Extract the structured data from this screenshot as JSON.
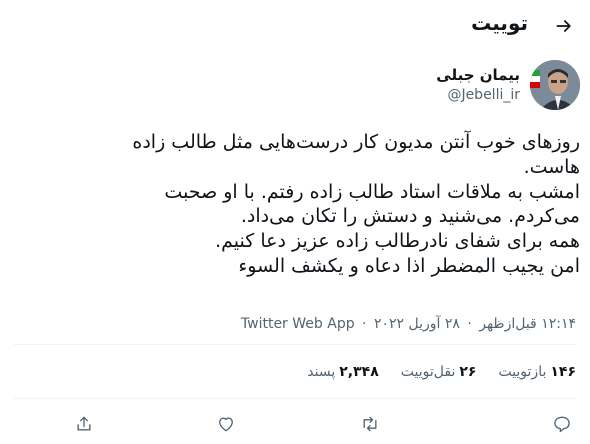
{
  "header": {
    "title": "توییت",
    "back_icon": "arrow-right-icon"
  },
  "author": {
    "name": "بیمان جبلی",
    "handle": "@Jebelli_ir"
  },
  "tweet": {
    "lines": [
      "روزهای خوب آنتن مدیون کار درست‌هایی مثل طالب زاده",
      "هاست.",
      "امشب به ملاقات استاد طالب زاده رفتم. با او صحبت",
      "می‌کردم. می‌شنید و دستش را تکان می‌داد.",
      "همه برای شفای نادرطالب زاده عزیز دعا کنیم.",
      "امن یجیب المضطر اذا دعاه و یکشف السوء"
    ]
  },
  "meta": {
    "time": "۱۲:۱۴ قبل‌ازظهر",
    "date": "۲۸ آوریل ۲۰۲۲",
    "source": "Twitter Web App",
    "separator": "·"
  },
  "stats": {
    "retweets": {
      "count": "۱۴۶",
      "label": "بازتوییت"
    },
    "quotes": {
      "count": "۲۶",
      "label": "نقل‌توییت"
    },
    "likes": {
      "count": "۲,۳۴۸",
      "label": "پسند"
    }
  },
  "actions": [
    "reply-icon",
    "retweet-icon",
    "like-icon",
    "share-icon"
  ],
  "colors": {
    "text": "#0f1419",
    "secondary": "#536471",
    "divider": "#eff3f4"
  }
}
